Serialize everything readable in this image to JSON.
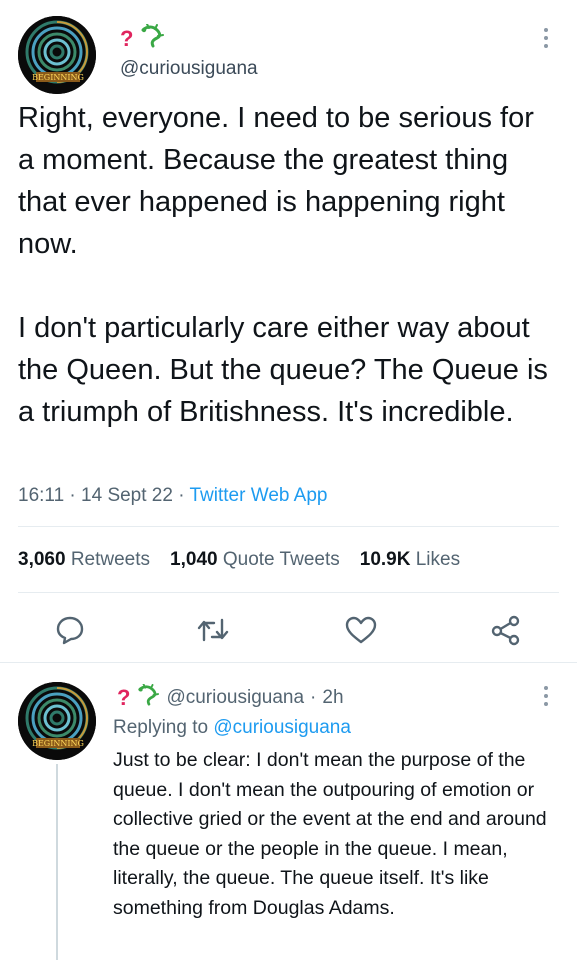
{
  "main_tweet": {
    "author": {
      "name_glyph": "?",
      "name_emoji": "lizard-icon",
      "handle": "@curiousiguana",
      "avatar_banner_text": "BEGINNING"
    },
    "text": "Right, everyone. I need to be serious for a moment. Because the greatest thing that ever happened is happening right now.\n\nI don't particularly care either way about the Queen. But the queue? The Queue is a triumph of Britishness. It's incredible.",
    "time": "16:11",
    "date": "14 Sept 22",
    "source": "Twitter Web App",
    "stats": {
      "retweets_count": "3,060",
      "retweets_label": "Retweets",
      "quotes_count": "1,040",
      "quotes_label": "Quote Tweets",
      "likes_count": "10.9K",
      "likes_label": "Likes"
    },
    "actions": [
      "reply-icon",
      "retweet-icon",
      "like-icon",
      "share-icon"
    ]
  },
  "reply_tweet": {
    "author": {
      "name_glyph": "?",
      "name_emoji": "lizard-icon",
      "handle": "@curiousiguana",
      "time_ago": "2h"
    },
    "replying_prefix": "Replying to",
    "replying_to": "@curiousiguana",
    "text": "Just to be clear: I don't mean the purpose of the queue. I don't mean the outpouring of emotion or collective gried or the event at the end and around the queue or the people in the queue. I mean, literally, the queue. The queue itself. It's like something from Douglas Adams."
  },
  "colors": {
    "link": "#1d9bf0",
    "secondary_text": "#536471",
    "primary_text": "#0f1419",
    "name_glyph": "#e0245e"
  }
}
